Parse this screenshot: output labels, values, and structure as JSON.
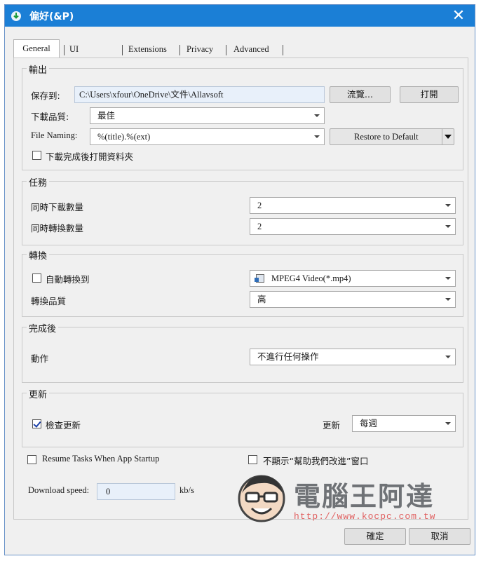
{
  "window": {
    "title": "偏好(&P)"
  },
  "tabs": [
    {
      "label": "General"
    },
    {
      "label": "UI Settings"
    },
    {
      "label": "Extensions"
    },
    {
      "label": "Privacy"
    },
    {
      "label": "Advanced"
    }
  ],
  "output": {
    "title": "輸出",
    "save_to_label": "保存到:",
    "save_path": "C:\\Users\\xfour\\OneDrive\\文件\\Allavsoft",
    "browse_label": "流覽...",
    "open_label": "打開",
    "quality_label": "下載品質:",
    "quality_value": "最佳",
    "naming_label": "File Naming:",
    "naming_value": "%(title).%(ext)",
    "restore_label": "Restore to Default",
    "open_folder_label": "下載完成後打開資料夾"
  },
  "tasks": {
    "title": "任務",
    "concurrent_downloads_label": "同時下載數量",
    "concurrent_downloads_value": "2",
    "concurrent_conversions_label": "同時轉換數量",
    "concurrent_conversions_value": "2"
  },
  "convert": {
    "title": "轉換",
    "auto_convert_label": "自動轉換到",
    "format_value": "MPEG4 Video(*.mp4)",
    "quality_label": "轉換品質",
    "quality_value": "高"
  },
  "after": {
    "title": "完成後",
    "action_label": "動作",
    "action_value": "不進行任何操作"
  },
  "update": {
    "title": "更新",
    "check_label": "檢查更新",
    "check_checked": true,
    "freq_label": "更新",
    "freq_value": "每週"
  },
  "misc": {
    "resume_label": "Resume Tasks When App Startup",
    "no_help_label": "不顯示“幫助我們改進”窗口",
    "speed_label": "Download speed:",
    "speed_value": "0",
    "speed_unit": "kb/s"
  },
  "watermark": {
    "text": "電腦王阿達",
    "url": "http://www.kocpc.com.tw"
  },
  "footer": {
    "ok_label": "確定",
    "cancel_label": "取消"
  }
}
